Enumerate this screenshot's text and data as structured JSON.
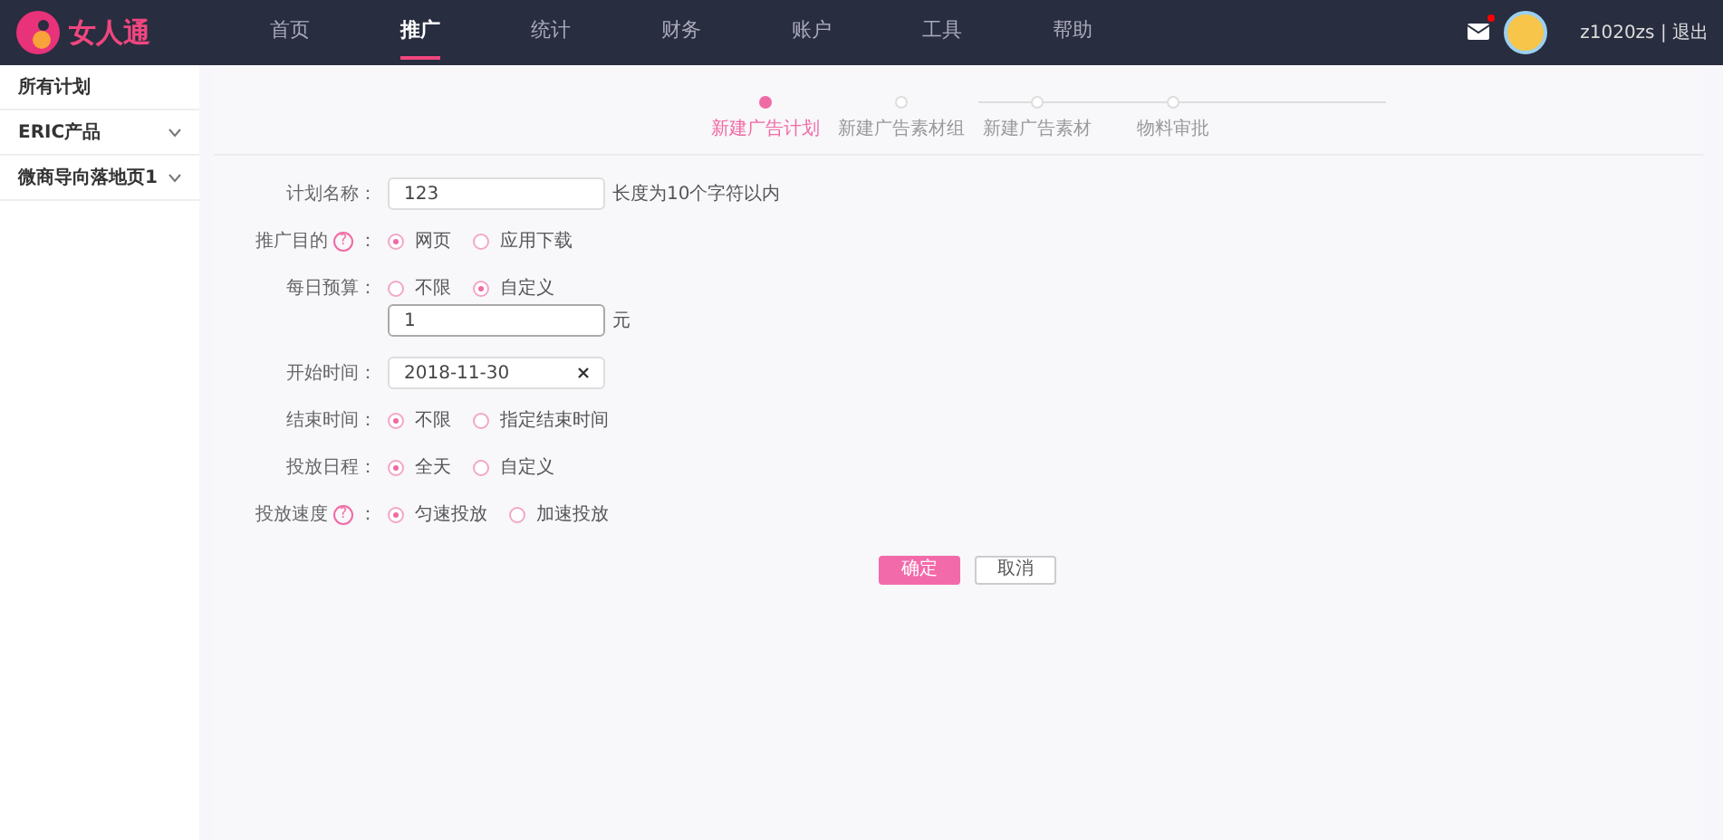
{
  "logo": {
    "text": "女人通"
  },
  "nav": [
    {
      "label": "首页",
      "selected": false
    },
    {
      "label": "推广",
      "selected": true
    },
    {
      "label": "统计",
      "selected": false
    },
    {
      "label": "财务",
      "selected": false
    },
    {
      "label": "账户",
      "selected": false
    },
    {
      "label": "工具",
      "selected": false
    },
    {
      "label": "帮助",
      "selected": false
    }
  ],
  "header": {
    "mail_unread": true,
    "user": "z1020zs | 退出"
  },
  "sidebar": [
    {
      "label": "所有计划",
      "expandable": false
    },
    {
      "label": "ERIC产品",
      "expandable": true
    },
    {
      "label": "微商导向落地页1",
      "expandable": true
    }
  ],
  "steps": [
    {
      "label": "新建广告计划",
      "selected": true
    },
    {
      "label": "新建广告素材组",
      "selected": false
    },
    {
      "label": "新建广告素材",
      "selected": false
    },
    {
      "label": "物料审批",
      "selected": false
    }
  ],
  "form": [
    {
      "kind": "text",
      "label": "计划名称：",
      "value": "123",
      "hint": "长度为10个字符以内"
    },
    {
      "kind": "radio",
      "label": "推广目的",
      "help": "?",
      "colon": "：",
      "options": [
        {
          "label": "网页",
          "selected": true
        },
        {
          "label": "应用下载",
          "selected": false
        }
      ]
    },
    {
      "kind": "radio",
      "label": "每日预算：",
      "options": [
        {
          "label": "不限",
          "selected": false
        },
        {
          "label": "自定义",
          "selected": true
        }
      ]
    },
    {
      "kind": "amount",
      "value": "1",
      "unit": "元"
    },
    {
      "kind": "date",
      "label": "开始时间：",
      "value": "2018-11-30"
    },
    {
      "kind": "radio",
      "label": "结束时间：",
      "options": [
        {
          "label": "不限",
          "selected": true
        },
        {
          "label": "指定结束时间",
          "selected": false
        }
      ]
    },
    {
      "kind": "radio",
      "label": "投放日程：",
      "options": [
        {
          "label": "全天",
          "selected": true
        },
        {
          "label": "自定义",
          "selected": false
        }
      ]
    },
    {
      "kind": "radio",
      "label": "投放速度",
      "help": "?",
      "colon": "：",
      "options": [
        {
          "label": "匀速投放",
          "selected": true
        },
        {
          "label": "加速投放",
          "selected": false
        }
      ]
    }
  ],
  "buttons": [
    {
      "label": "确定",
      "kind": "primary"
    },
    {
      "label": "取消",
      "kind": "secondary"
    }
  ]
}
